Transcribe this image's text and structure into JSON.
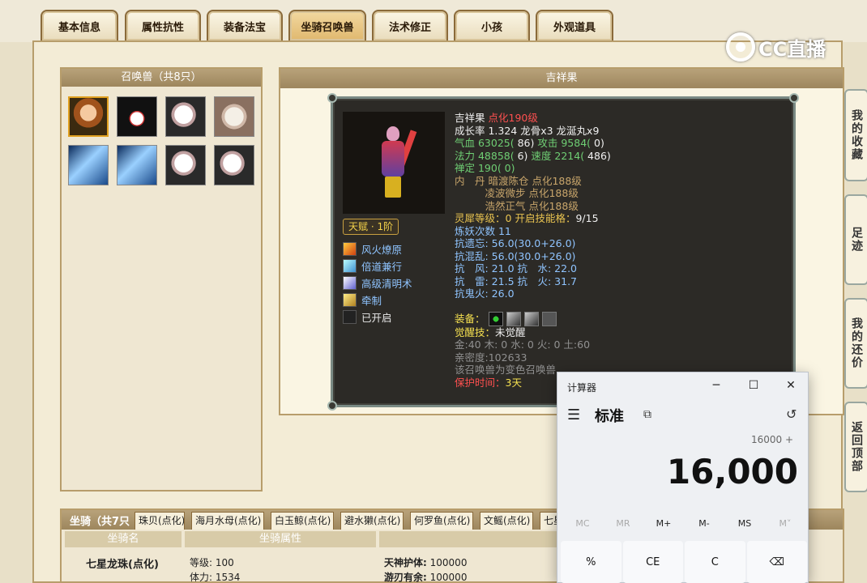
{
  "tabs": [
    {
      "label": "基本信息"
    },
    {
      "label": "属性抗性"
    },
    {
      "label": "装备法宝"
    },
    {
      "label": "坐骑召唤兽"
    },
    {
      "label": "法术修正"
    },
    {
      "label": "小孩"
    },
    {
      "label": "外观道具"
    }
  ],
  "logo": {
    "text": "CC直播"
  },
  "summons": {
    "title": "召唤兽（共8只）"
  },
  "pet_info": {
    "title": "吉祥果",
    "talent": "天赋 · 1阶",
    "skills": [
      "风火燎原",
      "倍道兼行",
      "高级清明术",
      "牵制",
      "已开启"
    ],
    "name": "吉祥果",
    "level": "点化190级",
    "growth": "成长率 1.324 龙骨x3 龙涎丸x9",
    "hp_label": "气血 63025(",
    "hp_extra": " 86)",
    "atk_label": " 攻击 9584(",
    "atk_extra": " 0)",
    "mp_label": "法力 48858(",
    "mp_extra": " 6)",
    "spd_label": " 速度 2214(",
    "spd_extra": " 486)",
    "zen": "禅定 190( 0)",
    "neidan1": "内　丹 暗渡陈仓 点化188级",
    "neidan2": "　　　凌波微步 点化188级",
    "neidan3": "　　　浩然正气 点化188级",
    "lingxi_label": "灵犀等级：",
    "lingxi_value": "0 开启技能格：",
    "lingxi_slots": "9/15",
    "lianyao": "炼妖次数 11",
    "res_forget": "抗遗忘: 56.0(30.0+26.0)",
    "res_chaos": "抗混乱: 56.0(30.0+26.0)",
    "res_wind_water": "抗　风: 21.0 抗　水: 22.0",
    "res_thunder_fire": "抗　雷: 21.5 抗　火: 31.7",
    "res_ghostfire": "抗鬼火: 26.0",
    "equip_label": "装备：",
    "awaken_label": "觉醒技：",
    "awaken_value": "未觉醒",
    "elements": "金:40 木: 0 水: 0 火: 0 土:60",
    "intimacy": "亲密度:102633",
    "transform": "该召唤兽为变色召唤兽",
    "protect_label": "保护时间：",
    "protect_value": "3天"
  },
  "mounts": {
    "title": "坐骑（共7只",
    "tabs": [
      "珠贝(点化)",
      "海月水母(点化)",
      "白玉鲸(点化)",
      "避水獭(点化)",
      "何罗鱼(点化)",
      "文鳐(点化)",
      "七星"
    ],
    "col_name": "坐骑名",
    "col_attr": "坐骑属性",
    "row_name": "七星龙珠(点化)",
    "attr1_label": "等级:",
    "attr1_value": "100",
    "attr2_label": "体力:",
    "attr2_value": "1534",
    "attr3_label": "天神护体:",
    "attr3_value": "100000",
    "attr4_label": "游刃有余:",
    "attr4_value": "100000"
  },
  "side_buttons": [
    "我的收藏",
    "足迹",
    "我的还价",
    "返回顶部"
  ],
  "calculator": {
    "title": "计算器",
    "mode": "标准",
    "expression": "16000 +",
    "display": "16,000",
    "memory": [
      "MC",
      "MR",
      "M+",
      "M-",
      "MS",
      "M˅"
    ],
    "keys": [
      "%",
      "CE",
      "C",
      "⌫"
    ]
  }
}
